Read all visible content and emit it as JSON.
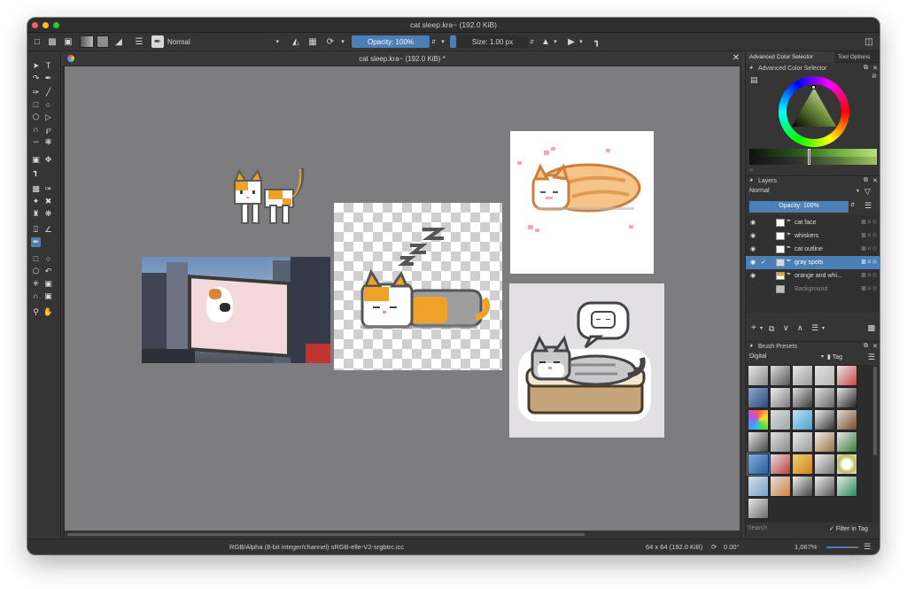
{
  "window": {
    "title": "cat sleep.kra~ (192.0 KiB)"
  },
  "toolbar": {
    "blend_mode": "Normal",
    "opacity_label": "Opacity: 100%",
    "size_label": "Size: 1.00 px"
  },
  "document_tab": {
    "title": "cat sleep.kra~ (192.0 KiB) *"
  },
  "dockers": {
    "tab_advanced_color": "Advanced Color Selector",
    "tab_tool_options": "Tool Options",
    "color_panel_title": "Advanced Color Selector",
    "layers": {
      "title": "Layers",
      "blend_mode": "Normal",
      "opacity": "Opacity: 100%",
      "items": [
        {
          "name": "cat face"
        },
        {
          "name": "whiskers"
        },
        {
          "name": "cat outline"
        },
        {
          "name": "gray spots"
        },
        {
          "name": "orange and whi..."
        },
        {
          "name": "Background"
        }
      ]
    },
    "brush_presets": {
      "title": "Brush Presets",
      "filter": "Digital",
      "tag_label": "Tag",
      "search_placeholder": "Search",
      "filter_in_tag": "Filter in Tag"
    }
  },
  "statusbar": {
    "color_space": "RGB/Alpha (8-bit integer/channel)  sRGB-elle-V2-srgbtrc.icc",
    "image_size": "64 x 64 (192.0 KiB)",
    "rotation": "0.00°",
    "zoom": "1,067%"
  },
  "colors": {
    "accent": "#4b7fb5",
    "canvas_bg": "#7d7c7f",
    "panel_bg": "#353535",
    "cat_orange": "#f0a228"
  }
}
